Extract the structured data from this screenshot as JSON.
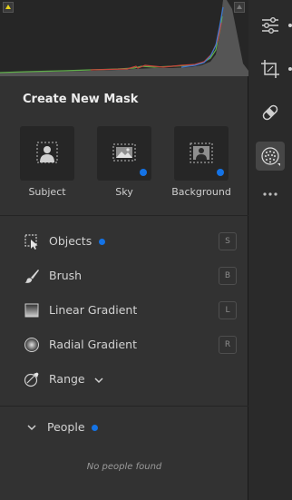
{
  "histogram": {
    "colors": {
      "red": "#c8463c",
      "green": "#5fae4a",
      "blue": "#3c78d2",
      "base": "#8a8a8a"
    }
  },
  "mask_panel": {
    "title": "Create New Mask",
    "tiles": [
      {
        "label": "Subject",
        "icon": "person-silhouette-icon",
        "has_dot": false
      },
      {
        "label": "Sky",
        "icon": "sky-landscape-icon",
        "has_dot": true
      },
      {
        "label": "Background",
        "icon": "background-person-icon",
        "has_dot": true
      }
    ],
    "tools": [
      {
        "label": "Objects",
        "icon": "objects-select-icon",
        "shortcut": "S",
        "has_dot": true
      },
      {
        "label": "Brush",
        "icon": "brush-icon",
        "shortcut": "B",
        "has_dot": false
      },
      {
        "label": "Linear Gradient",
        "icon": "linear-gradient-icon",
        "shortcut": "L",
        "has_dot": false
      },
      {
        "label": "Radial Gradient",
        "icon": "radial-gradient-icon",
        "shortcut": "R",
        "has_dot": false
      },
      {
        "label": "Range",
        "icon": "range-picker-icon",
        "shortcut": "",
        "has_dot": false
      }
    ],
    "people": {
      "label": "People",
      "empty_message": "No people found"
    }
  },
  "rail": {
    "items": [
      "edit-sliders-icon",
      "crop-icon",
      "healing-bandage-icon",
      "masking-icon",
      "more-icon"
    ]
  },
  "colors": {
    "accent_dot": "#1473e6",
    "panel_bg": "#323232"
  }
}
